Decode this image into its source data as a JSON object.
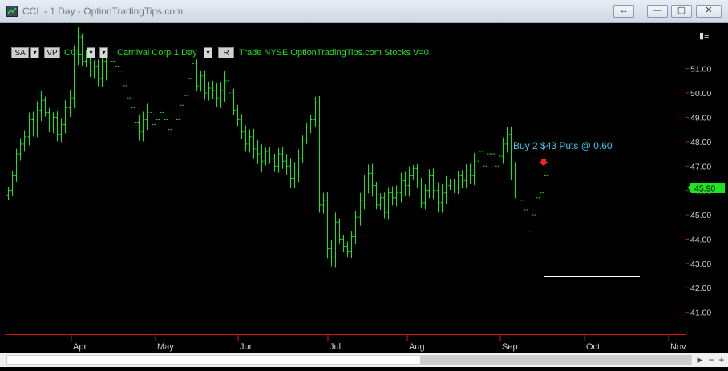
{
  "window": {
    "title": "CCL - 1 Day - OptionTradingTips.com",
    "buttons": [
      "↔",
      "—",
      "▢",
      "✕"
    ]
  },
  "toolbar": {
    "sa_label": "SA",
    "vp_label": "VP",
    "symbol": "CCL",
    "company": "Carnival Corp.",
    "interval": "1 Day",
    "r_label": "R",
    "info": "Trade  NYSE  OptionTradingTips.com  Stocks  V=0"
  },
  "colors": {
    "bars": "#19e619",
    "text_green": "#19e619",
    "annotation": "#3ec6f0",
    "axis_red": "#e01010",
    "price_tag_bg": "#1ee61e",
    "arrow_red": "#ff2020",
    "background": "#000000"
  },
  "annotation": {
    "text": "Buy 2 $43 Puts @ 0.60"
  },
  "price_tag": "45.90",
  "chart_data": {
    "type": "ohlc",
    "interval": "1 Day",
    "symbol": "CCL",
    "y_ticks": [
      "51.00",
      "50.00",
      "49.00",
      "48.00",
      "47.00",
      "46.00",
      "45.00",
      "44.00",
      "43.00",
      "42.00",
      "41.00"
    ],
    "ylim": [
      40.1,
      52.7
    ],
    "x_ticks": [
      "Apr",
      "May",
      "Jun",
      "Jul",
      "Aug",
      "Sep",
      "Oct",
      "Nov"
    ],
    "last_price": 45.9,
    "annotation_value": 0.6,
    "horizontal_line_level": 42.4,
    "path": [
      46.0,
      46.6,
      47.5,
      47.9,
      48.2,
      48.9,
      48.6,
      49.3,
      49.7,
      49.2,
      48.6,
      49.0,
      48.3,
      48.7,
      49.4,
      49.8,
      51.6,
      52.3,
      51.3,
      51.6,
      50.9,
      51.1,
      50.6,
      51.3,
      50.9,
      51.3,
      51.1,
      50.9,
      50.3,
      49.8,
      49.4,
      48.8,
      48.4,
      48.9,
      49.2,
      48.7,
      48.9,
      49.2,
      48.9,
      48.5,
      49.1,
      48.9,
      49.5,
      49.9,
      50.6,
      51.2,
      50.3,
      50.7,
      50.0,
      50.2,
      50.1,
      49.8,
      50.1,
      50.5,
      50.0,
      49.3,
      48.9,
      48.4,
      47.9,
      48.2,
      47.7,
      47.5,
      47.2,
      47.6,
      47.3,
      47.0,
      47.5,
      47.2,
      47.0,
      46.5,
      46.8,
      47.3,
      48.1,
      48.6,
      48.9,
      49.6,
      45.4,
      45.6,
      43.6,
      43.3,
      44.7,
      44.0,
      43.7,
      43.5,
      44.1,
      44.9,
      45.6,
      46.3,
      46.7,
      46.2,
      45.4,
      45.7,
      45.1,
      45.9,
      45.7,
      45.9,
      46.4,
      46.2,
      46.6,
      46.9,
      46.3,
      45.5,
      46.0,
      46.6,
      46.0,
      45.5,
      45.9,
      46.2,
      46.3,
      46.1,
      46.6,
      46.4,
      46.8,
      46.6,
      47.2,
      47.6,
      47.0,
      47.5,
      47.5,
      47.0,
      47.4,
      47.9,
      48.3,
      46.8,
      46.1,
      45.6,
      45.2,
      44.3,
      45.0,
      45.7,
      45.9,
      46.6,
      46.1
    ]
  }
}
